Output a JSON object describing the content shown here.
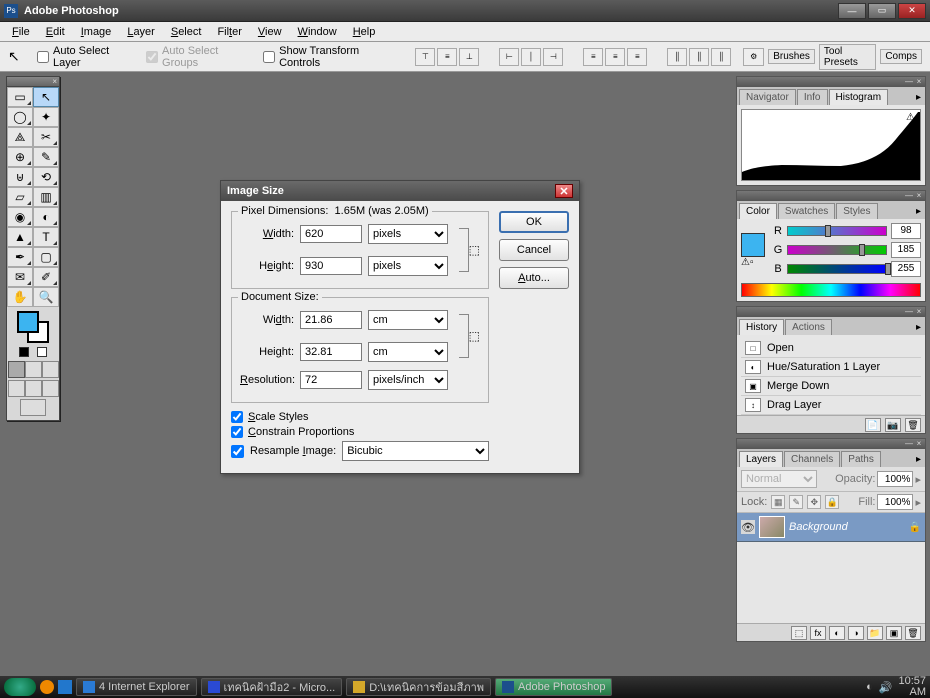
{
  "app": {
    "title": "Adobe Photoshop"
  },
  "menu": [
    "File",
    "Edit",
    "Image",
    "Layer",
    "Select",
    "Filter",
    "View",
    "Window",
    "Help"
  ],
  "options": {
    "autoSelectLayer": "Auto Select Layer",
    "autoSelectGroups": "Auto Select Groups",
    "showTransform": "Show Transform Controls",
    "tabs": [
      "Brushes",
      "Tool Presets",
      "Comps"
    ]
  },
  "dialog": {
    "title": "Image Size",
    "pixelDimLabel": "Pixel Dimensions:",
    "pixelDimValue": "1.65M (was 2.05M)",
    "widthLabel": "Width:",
    "heightLabel": "Height:",
    "pxWidth": "620",
    "pxHeight": "930",
    "pxUnit": "pixels",
    "docSizeLabel": "Document Size:",
    "docWidth": "21.86",
    "docHeight": "32.81",
    "docUnit": "cm",
    "resLabel": "Resolution:",
    "resolution": "72",
    "resUnit": "pixels/inch",
    "scaleStyles": "Scale Styles",
    "constrain": "Constrain Proportions",
    "resample": "Resample Image:",
    "resampleMethod": "Bicubic",
    "ok": "OK",
    "cancel": "Cancel",
    "auto": "Auto..."
  },
  "navigator": {
    "tabs": [
      "Navigator",
      "Info",
      "Histogram"
    ]
  },
  "color": {
    "tabs": [
      "Color",
      "Swatches",
      "Styles"
    ],
    "r": "98",
    "g": "185",
    "b": "255"
  },
  "history": {
    "tabs": [
      "History",
      "Actions"
    ],
    "items": [
      "Open",
      "Hue/Saturation 1 Layer",
      "Merge Down",
      "Drag Layer"
    ]
  },
  "layers": {
    "tabs": [
      "Layers",
      "Channels",
      "Paths"
    ],
    "blend": "Normal",
    "opacityLabel": "Opacity:",
    "opacity": "100%",
    "lockLabel": "Lock:",
    "fillLabel": "Fill:",
    "fill": "100%",
    "layerName": "Background"
  },
  "taskbar": {
    "items": [
      {
        "label": "4 Internet Explorer",
        "icon": "#2a7ad4"
      },
      {
        "label": "เทคนิคฝ้ามือ2 - Micro...",
        "icon": "#2a4ad4"
      },
      {
        "label": "D:\\เทคนิคการข้อมสีภาพ",
        "icon": "#d4a82a"
      },
      {
        "label": "Adobe Photoshop",
        "icon": "#1c4f8c",
        "active": true
      }
    ],
    "time": "10:57",
    "ampm": "AM"
  }
}
